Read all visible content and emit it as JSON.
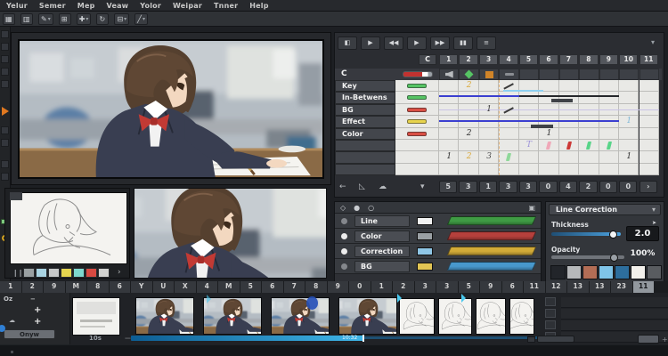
{
  "menu": {
    "items": [
      "Yelur",
      "Semer",
      "Mep",
      "Veaw",
      "Yolor",
      "Weipar",
      "Tnner",
      "Help"
    ]
  },
  "toolbar": {
    "icons": [
      {
        "name": "grid-icon",
        "glyph": "▦",
        "dropdown": false
      },
      {
        "name": "grid-alt-icon",
        "glyph": "▥",
        "dropdown": false
      },
      {
        "name": "pencil-tool-icon",
        "glyph": "✎",
        "dropdown": true
      },
      {
        "name": "transform-tool-icon",
        "glyph": "⊞",
        "dropdown": false
      },
      {
        "name": "add-tool-icon",
        "glyph": "✚",
        "dropdown": true
      },
      {
        "name": "rotate-tool-icon",
        "glyph": "↻",
        "dropdown": false
      },
      {
        "name": "layers-tool-icon",
        "glyph": "⊟",
        "dropdown": true
      },
      {
        "name": "line-tool-icon",
        "glyph": "╱",
        "dropdown": true
      }
    ]
  },
  "xsheet": {
    "transport": [
      {
        "name": "slate-icon",
        "glyph": "◧"
      },
      {
        "name": "play-icon",
        "glyph": "▶"
      },
      {
        "name": "prev-frame-icon",
        "glyph": "◀◀"
      },
      {
        "name": "play-alt-icon",
        "glyph": "▶"
      },
      {
        "name": "next-frame-icon",
        "glyph": "▶▶"
      },
      {
        "name": "pause-icon",
        "glyph": "▮▮"
      },
      {
        "name": "list-icon",
        "glyph": "≡"
      }
    ],
    "panel_chevron": "▾",
    "corner_label": "C",
    "columns": [
      "1",
      "2",
      "3",
      "4",
      "5",
      "6",
      "7",
      "8",
      "9",
      "10",
      "11"
    ],
    "current_row": {
      "label": "C",
      "cells": [
        {
          "col": 1,
          "icon": "speaker-icon",
          "color": "#b8bbbe"
        },
        {
          "col": 2,
          "icon": "diamond-icon",
          "color": "#56c464"
        },
        {
          "col": 3,
          "icon": "square-icon",
          "color": "#d08428"
        },
        {
          "col": 4,
          "icon": "dash-icon",
          "color": "#8a8d92"
        }
      ]
    },
    "rows": [
      {
        "label": "Key",
        "chip": "#56c464"
      },
      {
        "label": "In-Betwens",
        "chip": "#56c464"
      },
      {
        "label": "BG",
        "chip": "#d94f44"
      },
      {
        "label": "Effect",
        "chip": "#e8d44d"
      },
      {
        "label": "Color",
        "chip": "#d94f44"
      },
      {
        "label": "",
        "chip": ""
      },
      {
        "label": "",
        "chip": ""
      },
      {
        "label": "",
        "chip": ""
      }
    ],
    "marks": {
      "texts": [
        {
          "row": 0,
          "col": 2,
          "text": "2",
          "color": "#d9a93c"
        },
        {
          "row": 2,
          "col": 3,
          "text": "1",
          "color": "#3c3c3c"
        },
        {
          "row": 3,
          "col": 10,
          "text": "1",
          "color": "#7fb8d8"
        },
        {
          "row": 4,
          "col": 2,
          "text": "2",
          "color": "#2f2f2f"
        },
        {
          "row": 4,
          "col": 6,
          "text": "1",
          "color": "#2f2f2f"
        },
        {
          "row": 5,
          "col": 5,
          "text": "T",
          "color": "#9a90d8"
        },
        {
          "row": 6,
          "col": 1,
          "text": "1",
          "color": "#2f2f2f"
        },
        {
          "row": 6,
          "col": 2,
          "text": "2",
          "color": "#d9a93c"
        },
        {
          "row": 6,
          "col": 3,
          "text": "3",
          "color": "#4a4a4a"
        },
        {
          "row": 6,
          "col": 10,
          "text": "1",
          "color": "#2f2f2f"
        }
      ],
      "lines": [
        {
          "row": 0,
          "from": 3.2,
          "to": 5.2,
          "color": "#8fd0f0",
          "frac": 0.8,
          "h": 2
        },
        {
          "row": 1,
          "from": 0,
          "to": 4.0,
          "color": "#3b3fd0",
          "frac": 0.3,
          "h": 2
        },
        {
          "row": 1,
          "from": 4.0,
          "to": 9.0,
          "color": "#26282b",
          "frac": 0.25,
          "h": 2
        },
        {
          "row": 1,
          "from": 5.6,
          "to": 6.7,
          "color": "#3f4247",
          "frac": 0.55,
          "h": 4
        },
        {
          "row": 2,
          "from": 0,
          "to": 11,
          "color": "#c9c4e6",
          "frac": 0.45,
          "h": 1
        },
        {
          "row": 3,
          "from": 0,
          "to": 9.0,
          "color": "#3b3fd0",
          "frac": 0.35,
          "h": 2
        },
        {
          "row": 3,
          "from": 4.6,
          "to": 5.7,
          "color": "#3f4247",
          "frac": 0.7,
          "h": 4
        }
      ],
      "slashes": [
        {
          "row": 0,
          "col": 4
        },
        {
          "row": 2,
          "col": 4
        }
      ],
      "vbars": [
        {
          "row": 5,
          "col": 6,
          "color": "#f0a8b8"
        },
        {
          "row": 5,
          "col": 7,
          "color": "#cc3836"
        },
        {
          "row": 5,
          "col": 8,
          "color": "#58d488"
        },
        {
          "row": 5,
          "col": 9,
          "color": "#58d488"
        },
        {
          "row": 6,
          "col": 4,
          "color": "#8fd89a"
        }
      ]
    },
    "bottom_icons": [
      {
        "name": "back-arrow-icon",
        "glyph": "←"
      },
      {
        "name": "curve-icon",
        "glyph": "◺"
      },
      {
        "name": "cloud-icon",
        "glyph": "☁"
      },
      {
        "name": "chevron-down-icon",
        "glyph": "▾"
      }
    ],
    "number_buttons": [
      "5",
      "3",
      "1",
      "3",
      "3",
      "0",
      "4",
      "2",
      "0",
      "0"
    ],
    "next_arrow": "›"
  },
  "layers": {
    "header_icons": [
      {
        "name": "diamond-filter-icon",
        "glyph": "◇"
      },
      {
        "name": "dot-filter-icon",
        "glyph": "●"
      },
      {
        "name": "circle-filter-icon",
        "glyph": "○"
      }
    ],
    "header_right_icon": "▣",
    "rows": [
      {
        "label": "Line",
        "swatch": "#f2f2f2",
        "bar": "#3f9b44",
        "dot": "#84878c"
      },
      {
        "label": "Color",
        "swatch": "#9aa0a4",
        "bar": "#b5403c",
        "dot": "#ececec"
      },
      {
        "label": "Correction",
        "swatch": "#8fc6e6",
        "bar": "#d2ab38",
        "dot": "#ececec"
      },
      {
        "label": "BG",
        "swatch": "#e2c554",
        "bar": "#4898cc",
        "dot": "#84878c"
      }
    ]
  },
  "line_correction": {
    "title": "Line Correction",
    "chevron": "▾",
    "thickness_label": "Thickness",
    "thickness_value": "2.0",
    "thickness_pct": 0.88,
    "opacity_label": "Opacity",
    "opacity_value": "100%",
    "opacity_pct": 0.85,
    "slider_color": "#4da3e0",
    "swatches": [
      "#22252a",
      "#b6b8ba",
      "#b26d55",
      "#7fc4e8",
      "#2d6e9d",
      "#f2f0eb",
      "#595c60"
    ]
  },
  "timeline": {
    "ruler": [
      "1",
      "2",
      "9",
      "M",
      "8",
      "6",
      "Y",
      "U",
      "X",
      "4",
      "M",
      "5",
      "6",
      "7",
      "8",
      "9",
      "0",
      "1",
      "2",
      "3",
      "3",
      "5",
      "9",
      "6",
      "11",
      "12",
      "13",
      "13",
      "23",
      "11"
    ],
    "active_index": 29,
    "oz_label": "Oz",
    "minus_label": "−",
    "plus_label": "+",
    "cloud_plus_label": "+",
    "grow_label": "Onyw",
    "sec_label": "10s",
    "time_label": "10:32",
    "colored_thumbs": [
      152,
      228,
      304,
      380
    ],
    "sketch_thumbs": [
      [
        448,
        40
      ],
      [
        492,
        38
      ],
      [
        534,
        34
      ],
      [
        572,
        28
      ]
    ]
  },
  "sketch_panel": {
    "palette": [
      "#9aa0a2",
      "#a9d3e2",
      "#c6c8c8",
      "#e4d44f",
      "#7ed8ce",
      "#d84a42",
      "#d2d2d0"
    ],
    "more_glyph": "›",
    "grip_glyph": "❙❙"
  }
}
